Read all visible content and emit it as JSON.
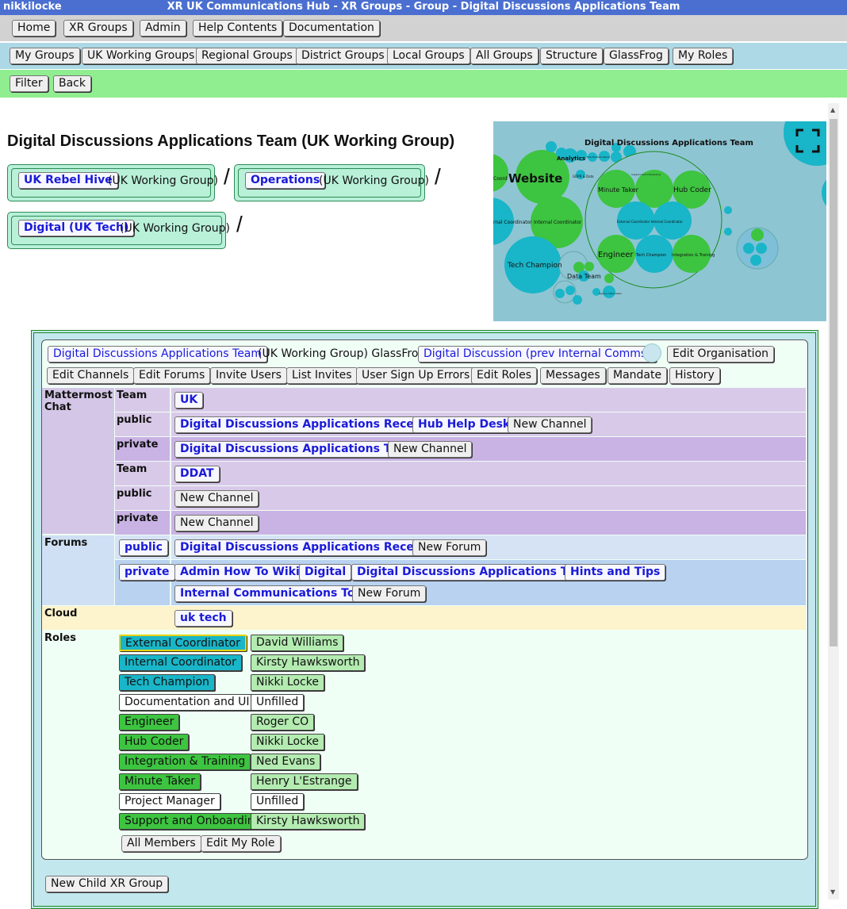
{
  "window": {
    "user": "nikkilocke",
    "title": "XR UK Communications Hub - XR Groups - Group - Digital Discussions Applications Team"
  },
  "nav1": [
    "Home",
    "XR Groups",
    "Admin",
    "Help Contents",
    "Documentation"
  ],
  "nav2": [
    "My Groups",
    "UK Working Groups",
    "Regional Groups",
    "District Groups",
    "Local Groups",
    "All Groups",
    "Structure",
    "GlassFrog",
    "My Roles"
  ],
  "nav3": [
    "Filter",
    "Back"
  ],
  "page_title": "Digital Discussions Applications Team (UK Working Group)",
  "breadcrumbs": [
    {
      "name": "UK Rebel Hive",
      "type": "(UK Working Group)"
    },
    {
      "name": "Operations",
      "type": "(UK Working Group)"
    },
    {
      "name": "Digital (UK Tech)",
      "type": "(UK Working Group)"
    }
  ],
  "slash": "/",
  "map": {
    "title": "Digital Discussions Applications Team",
    "labels": {
      "website": "Website",
      "coord": "Coord",
      "analytics": "Analytics",
      "minute_taker": "Minute Taker",
      "hub_coder": "Hub Coder",
      "engineer": "Engineer",
      "tech_champion": "Tech Champion",
      "tech_champion_inner": "Tech Champion",
      "integration": "Integration & Training",
      "internal_coordinator": "Internal Coordinator",
      "nal_coordinator": "rnal Coordinator",
      "ext_int_coord": "External Coordinator Internal Coordinator",
      "data_team": "Data Team",
      "gdpr": "GDPR & Data",
      "support_onboarding": "Support and Onboarding",
      "tiny1": "Hub Product Owner",
      "tiny2": "Agency Interviewer"
    }
  },
  "group": {
    "name": "Digital Discussions Applications Team",
    "type_text": "(UK Working Group) GlassFrog:",
    "glassfrog": "Digital Discussion (prev Internal Comms)",
    "edit_org": "Edit Organisation",
    "actions": [
      "Edit Channels",
      "Edit Forums",
      "Invite Users",
      "List Invites",
      "User Sign Up Errors",
      "Edit Roles",
      "Messages",
      "Mandate",
      "History"
    ]
  },
  "mattermost": {
    "label": "Mattermost Chat",
    "rows": [
      {
        "kind": "Team",
        "items": [
          "UK"
        ],
        "extra": ""
      },
      {
        "kind": "public",
        "items": [
          "Digital Discussions Applications Reception",
          "Hub Help Desk"
        ],
        "extra": "New Channel"
      },
      {
        "kind": "private",
        "items": [
          "Digital Discussions Applications Team"
        ],
        "extra": "New Channel"
      },
      {
        "kind": "Team",
        "items": [
          "DDAT"
        ],
        "extra": ""
      },
      {
        "kind": "public",
        "items": [],
        "extra": "New Channel"
      },
      {
        "kind": "private",
        "items": [],
        "extra": "New Channel"
      }
    ]
  },
  "forums": {
    "label": "Forums",
    "public_label": "public",
    "public_items": [
      "Digital Discussions Applications Reception"
    ],
    "public_extra": "New Forum",
    "private_label": "private",
    "private_items": [
      "Admin How To Wikis",
      "Digital",
      "Digital Discussions Applications Team",
      "Hints and Tips",
      "Internal Communications Tools"
    ],
    "private_extra": "New Forum"
  },
  "cloud": {
    "label": "Cloud",
    "item": "uk tech"
  },
  "roles": {
    "label": "Roles",
    "list": [
      {
        "role": "External Coordinator",
        "person": "David Williams"
      },
      {
        "role": "Internal Coordinator",
        "person": "Kirsty Hawksworth"
      },
      {
        "role": "Tech Champion",
        "person": "Nikki Locke"
      },
      {
        "role": "Documentation and UI",
        "person": "Unfilled"
      },
      {
        "role": "Engineer",
        "person": "Roger CO"
      },
      {
        "role": "Hub Coder",
        "person": "Nikki Locke"
      },
      {
        "role": "Integration & Training",
        "person": "Ned Evans"
      },
      {
        "role": "Minute Taker",
        "person": "Henry L'Estrange"
      },
      {
        "role": "Project Manager",
        "person": "Unfilled"
      },
      {
        "role": "Support and Onboarding",
        "person": "Kirsty Hawksworth"
      }
    ],
    "all_members": "All Members",
    "edit_my_role": "Edit My Role"
  },
  "new_child": "New Child XR Group",
  "colors": {
    "titlebar": "#4a6fd0",
    "teal": "#19b5c8",
    "green": "#3dc440",
    "map_bg": "#8ec5d3"
  }
}
